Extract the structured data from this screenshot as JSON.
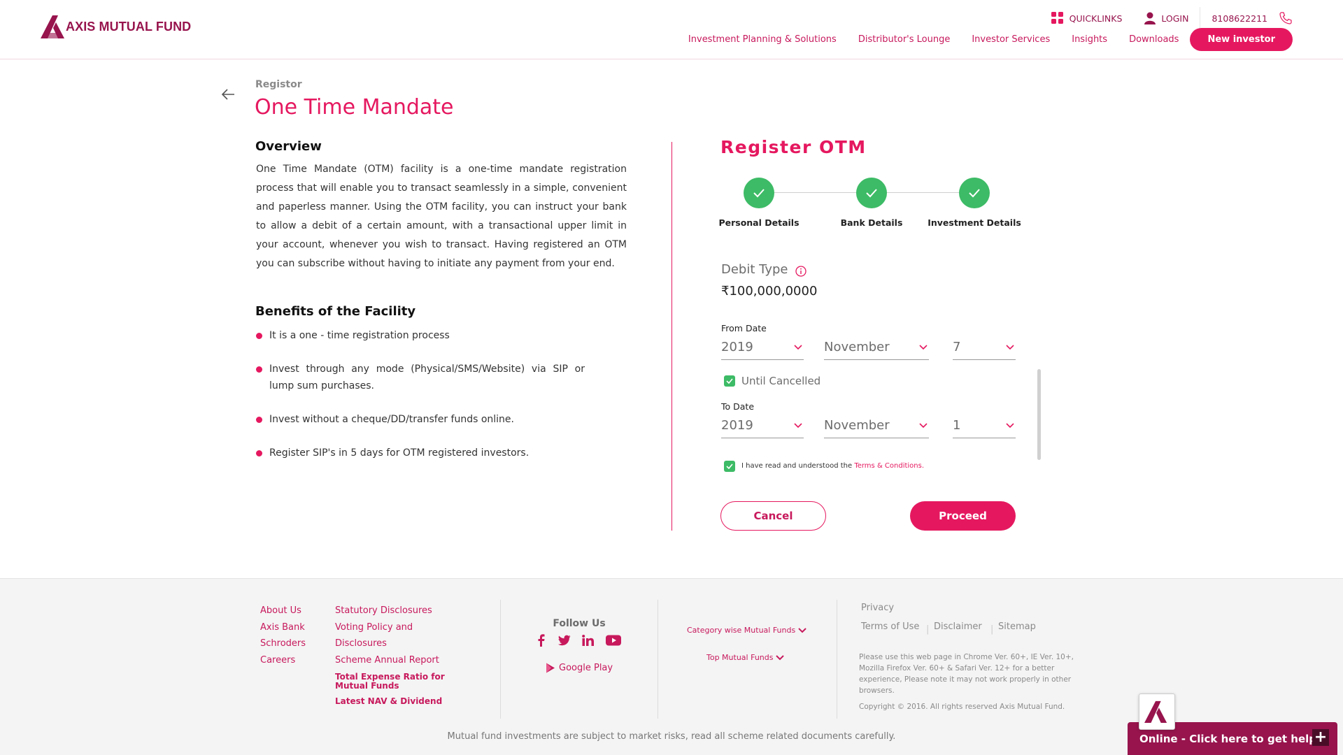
{
  "header": {
    "logo_text": "AXIS MUTUAL FUND",
    "quicklinks": "QUICKLINKS",
    "login": "LOGIN",
    "phone": "8108622211",
    "nav": [
      "Investment Planning & Solutions",
      "Distributor's Lounge",
      "Investor Services",
      "Insights",
      "Downloads"
    ],
    "new_investor": "New investor"
  },
  "page": {
    "breadcrumb": "Registor",
    "title": "One Time Mandate"
  },
  "overview": {
    "heading": "Overview",
    "text": "One Time Mandate (OTM) facility is a one-time mandate registration process that will enable you to transact seamlessly in a simple, convenient and paperless manner. Using the OTM facility, you can instruct your bank to allow a debit of a certain amount, with a transactional upper limit in your account, whenever you wish to transact. Having registered an OTM you can subscribe without having to initiate any payment from your end."
  },
  "benefits": {
    "heading": "Benefits of the Facility",
    "items": [
      "It is a one - time registration process",
      "Invest through any mode (Physical/SMS/Website) via SIP or lump sum purchases.",
      "Invest without a cheque/DD/transfer funds online.",
      "Register SIP's in 5 days for OTM registered investors."
    ]
  },
  "form": {
    "title": "Register OTM",
    "steps": [
      "Personal Details",
      "Bank Details",
      "Investment Details"
    ],
    "debit_type_label": "Debit Type",
    "amount": "₹100,000,0000",
    "from_label": "From Date",
    "from": {
      "year": "2019",
      "month": "November",
      "day": "7"
    },
    "until_cancelled": "Until Cancelled",
    "until_cancelled_checked": true,
    "to_label": "To Date",
    "to": {
      "year": "2019",
      "month": "November",
      "day": "1"
    },
    "terms_text": "I have read and understood the ",
    "terms_link": "Terms & Conditions.",
    "terms_checked": true,
    "cancel": "Cancel",
    "proceed": "Proceed"
  },
  "footer": {
    "col1": [
      "About Us",
      "Axis Bank",
      "Schroders",
      "Careers"
    ],
    "col2": [
      "Statutory Disclosures",
      "Voting Policy and Disclosures",
      "Scheme Annual Report"
    ],
    "col2_bold": [
      "Total Expense Ratio for Mutual Funds",
      "Latest NAV & Dividend"
    ],
    "follow_us": "Follow Us",
    "google_play": "Google Play",
    "category_funds": "Category wise Mutual Funds",
    "top_funds": "Top Mutual Funds",
    "privacy": "Privacy",
    "terms_of_use": "Terms of Use",
    "disclaimer_link": "Disclaimer",
    "sitemap": "Sitemap",
    "browser_note": "Please use this web page in Chrome Ver. 60+, IE Ver. 10+, Mozilla Firefox Ver. 60+ & Safari Ver. 12+ for a better experience, Please note it may not work properly in other browsers.",
    "copyright": "Copyright © 2016. All rights reserved Axis Mutual Fund.",
    "risk_disclaimer": "Mutual fund investments are subject to market risks, read all scheme related documents carefully."
  },
  "chat": {
    "label": "Online - Click here to get help",
    "plus": "+"
  },
  "colors": {
    "brand": "#97144d",
    "accent": "#e5185f",
    "success": "#3dbb66"
  }
}
